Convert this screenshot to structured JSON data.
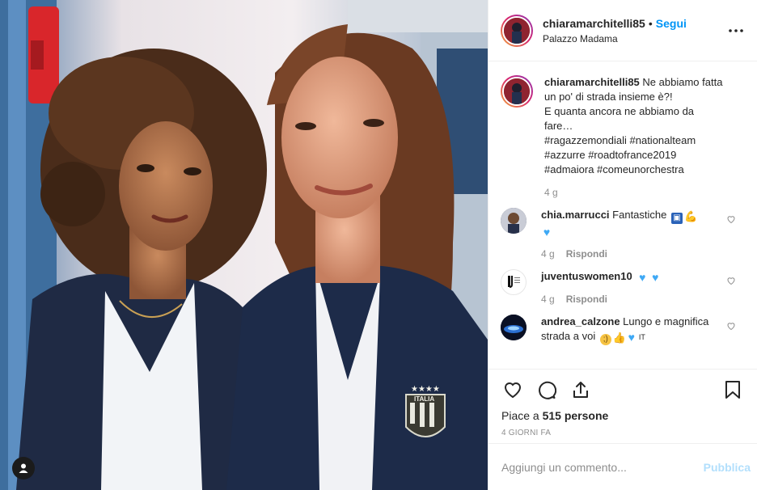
{
  "header": {
    "username": "chiaramarchitelli85",
    "separator": "•",
    "follow_label": "Segui",
    "location": "Palazzo Madama",
    "more_icon": "more-horizontal-icon"
  },
  "caption": {
    "username": "chiaramarchitelli85",
    "text": "Ne abbiamo fatta un po' di strada insieme è?!\nE quanta ancora ne abbiamo da fare…",
    "hashtags": "#ragazzemondiali #nationalteam\n#azzurre #roadtofrance2019\n#admaiora #comeunorchestra",
    "time": "4 g"
  },
  "comments": [
    {
      "username": "chia.marrucci",
      "text": "Fantastiche",
      "time": "4 g",
      "reply_label": "Rispondi"
    },
    {
      "username": "juventuswomen10",
      "text": "",
      "time": "4 g",
      "reply_label": "Rispondi"
    },
    {
      "username": "andrea_calzone",
      "text": "Lungo e magnifica strada a voi",
      "time": "",
      "reply_label": ""
    }
  ],
  "emoji_tail": "IT",
  "likes": {
    "prefix": "Piace a ",
    "count": "515 persone"
  },
  "timestamp": "4 GIORNI FA",
  "add_comment": {
    "placeholder": "Aggiungi un commento...",
    "publish_label": "Pubblica"
  },
  "colors": {
    "link_blue": "#0095f6",
    "hashtag": "#00376b",
    "muted": "#8e8e8e",
    "publish_disabled": "#b2dffc"
  }
}
